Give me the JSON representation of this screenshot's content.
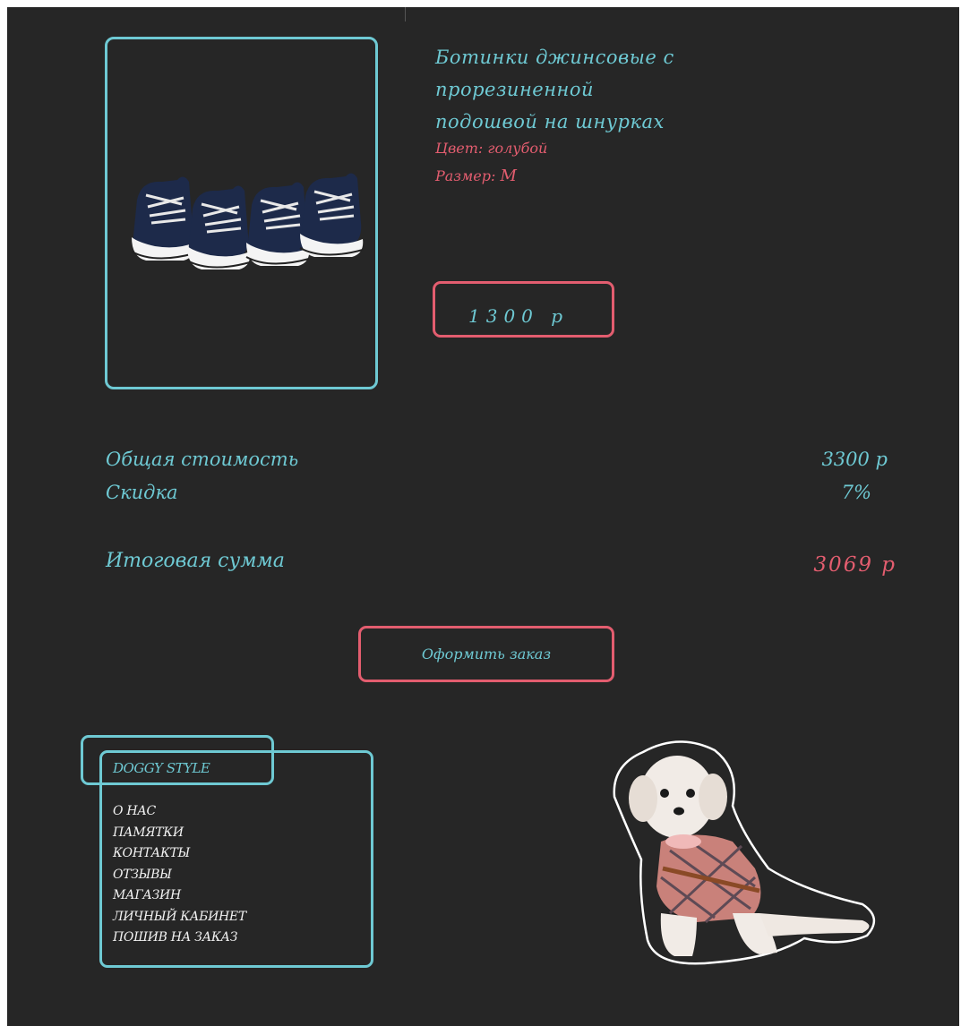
{
  "product": {
    "title_line1": "Ботинки джинсовые с прорезиненной",
    "title_line2": "подошвой на шнурках",
    "color_label": "Цвет:",
    "color_value": "голубой",
    "size_label": "Размер:",
    "size_value": "M",
    "price": "1300 р"
  },
  "summary": {
    "total_label": "Общая стоимость",
    "total_value": "3300 р",
    "discount_label": "Скидка",
    "discount_value": "7%",
    "final_label": "Итоговая сумма",
    "final_value": "3069 р"
  },
  "order_button": "Оформить заказ",
  "footer": {
    "brand": "DOGGY STYLE",
    "menu": [
      "О НАС",
      "ПАМЯТКИ",
      "КОНТАКТЫ",
      "ОТЗЫВЫ",
      "МАГАЗИН",
      "ЛИЧНЫЙ КАБИНЕТ",
      "ПОШИВ НА ЗАКАЗ"
    ]
  },
  "colors": {
    "accent_teal": "#6ec9d3",
    "accent_pink": "#e35d6f",
    "background": "#262626"
  }
}
